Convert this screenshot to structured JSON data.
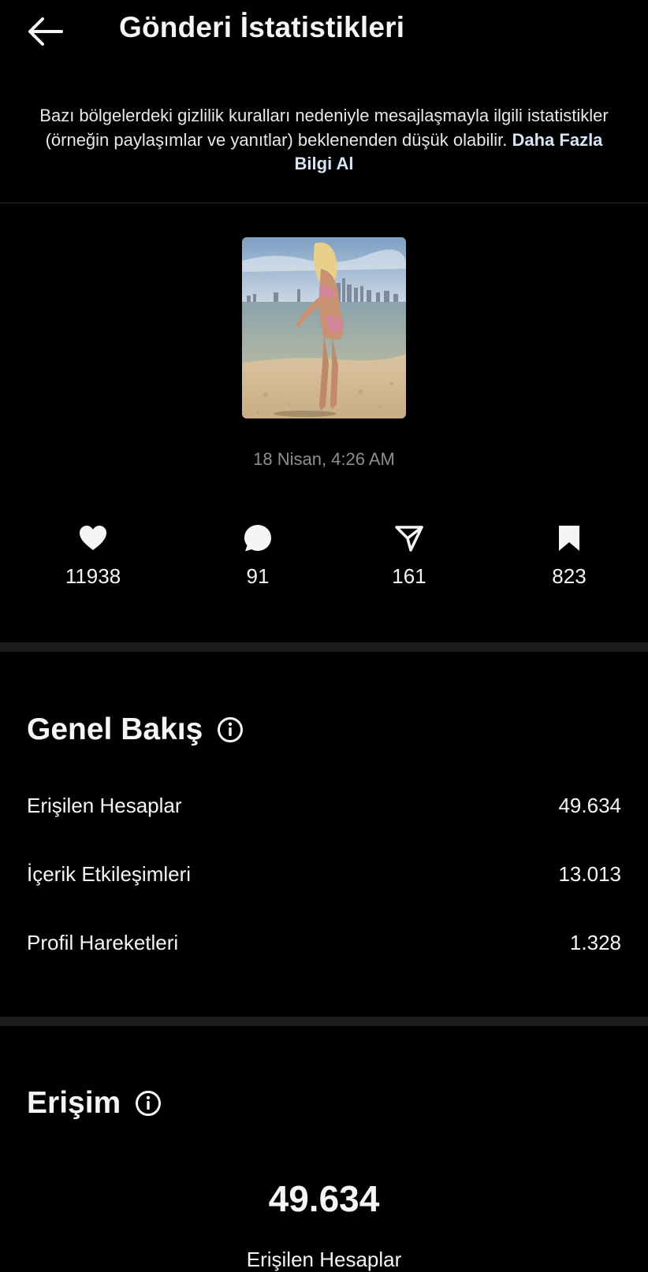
{
  "header": {
    "title": "Gönderi İstatistikleri",
    "back_icon": "arrow-left-icon"
  },
  "notice": {
    "text": "Bazı bölgelerdeki gizlilik kuralları nedeniyle mesajlaşmayla ilgili istatistikler (örneğin paylaşımlar ve yanıtlar) beklenenden düşük olabilir.",
    "link": "Daha Fazla Bilgi Al"
  },
  "post": {
    "date": "18 Nisan, 4:26 AM"
  },
  "stats": [
    {
      "icon": "heart-icon",
      "value": "11938"
    },
    {
      "icon": "comment-icon",
      "value": "91"
    },
    {
      "icon": "send-icon",
      "value": "161"
    },
    {
      "icon": "bookmark-icon",
      "value": "823"
    }
  ],
  "overview": {
    "title": "Genel Bakış",
    "rows": [
      {
        "label": "Erişilen Hesaplar",
        "value": "49.634"
      },
      {
        "label": "İçerik Etkileşimleri",
        "value": "13.013"
      },
      {
        "label": "Profil Hareketleri",
        "value": "1.328"
      }
    ]
  },
  "reach": {
    "title": "Erişim",
    "total": "49.634",
    "label": "Erişilen Hesaplar"
  },
  "colors": {
    "background": "#000000",
    "text": "#f5f5f5",
    "muted": "#8e8e8e",
    "link": "#d6e4f5",
    "divider": "#1c1c1c"
  }
}
